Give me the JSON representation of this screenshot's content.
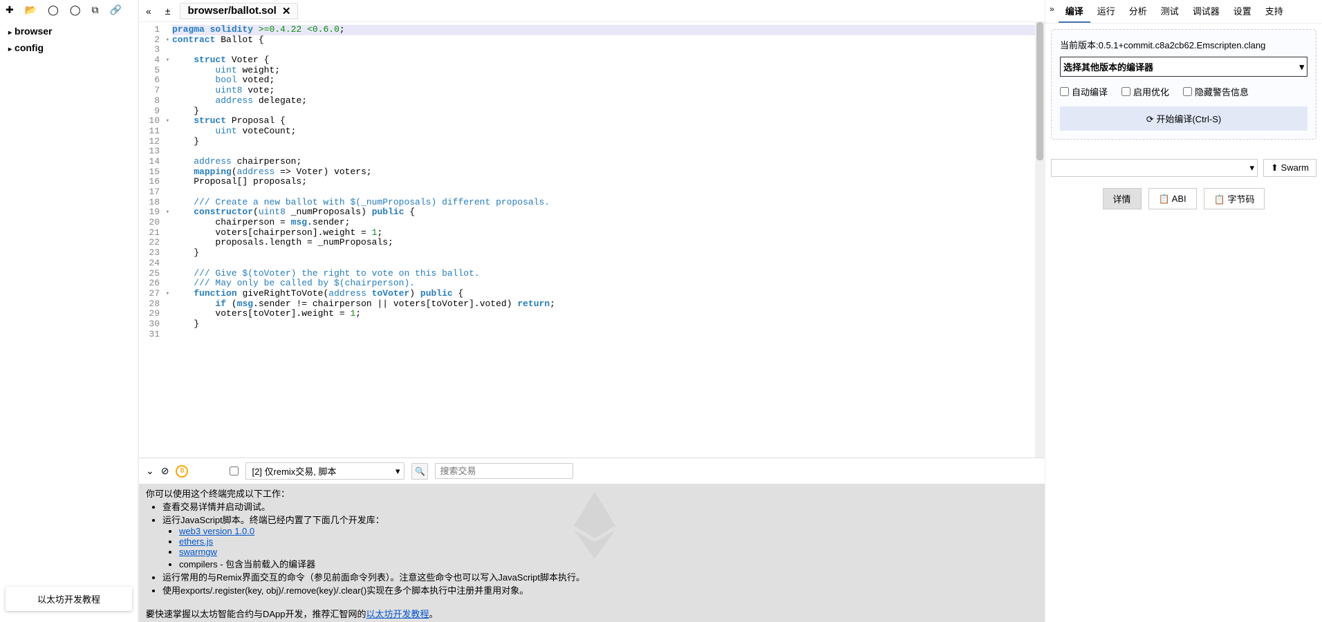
{
  "leftPanel": {
    "treeItems": [
      "browser",
      "config"
    ],
    "tutorialLabel": "以太坊开发教程"
  },
  "tab": {
    "title": "browser/ballot.sol"
  },
  "editor": {
    "lineCount": 31,
    "foldLines": [
      2,
      4,
      10,
      19,
      27
    ]
  },
  "terminalControls": {
    "pendingCount": "0",
    "filterLabel": "[2] 仅remix交易, 脚本",
    "searchPlaceholder": "搜索交易"
  },
  "terminal": {
    "intro": "你可以使用这个终端完成以下工作：",
    "bullets": [
      "查看交易详情并启动调试。",
      "运行JavaScript脚本。终端已经内置了下面几个开发库："
    ],
    "libs": [
      "web3 version 1.0.0",
      "ethers.js",
      "swarmgw"
    ],
    "compilersLine": "compilers - 包含当前载入的编译器",
    "bullets2": [
      "运行常用的与Remix界面交互的命令（参见前面命令列表）。注意这些命令也可以写入JavaScript脚本执行。",
      "使用exports/.register(key, obj)/.remove(key)/.clear()实现在多个脚本执行中注册并重用对象。"
    ],
    "footerText": "要快速掌握以太坊智能合约与DApp开发，推荐汇智网的",
    "footerLink": "以太坊开发教程",
    "prompt": ">"
  },
  "rightPanel": {
    "tabs": [
      "编译",
      "运行",
      "分析",
      "测试",
      "调试器",
      "设置",
      "支持"
    ],
    "activeTab": 0,
    "versionText": "当前版本:0.5.1+commit.c8a2cb62.Emscripten.clang",
    "compilerSelect": "选择其他版本的编译器",
    "opts": {
      "auto": "自动编译",
      "optimize": "启用优化",
      "hideWarn": "隐藏警告信息"
    },
    "compileBtn": "开始编译(Ctrl-S)",
    "swarmBtn": "Swarm",
    "detailBtn": "详情",
    "abiBtn": "ABI",
    "bytecodeBtn": "字节码"
  },
  "code": {
    "l1": {
      "a": "pragma",
      "b": "solidity",
      "c": ">=0.4.22 <0.6.0",
      "d": ";"
    },
    "l2": {
      "a": "contract",
      "b": " Ballot {"
    },
    "l4": {
      "a": "struct",
      "b": " Voter {"
    },
    "l5": {
      "a": "uint",
      "b": " weight;"
    },
    "l6": {
      "a": "bool",
      "b": " voted;"
    },
    "l7": {
      "a": "uint8",
      "b": " vote;"
    },
    "l8": {
      "a": "address",
      "b": " delegate;"
    },
    "l9": "    }",
    "l10": {
      "a": "struct",
      "b": " Proposal {"
    },
    "l11": {
      "a": "uint",
      "b": " voteCount;"
    },
    "l12": "    }",
    "l14": {
      "a": "address",
      "b": " chairperson;"
    },
    "l15": {
      "a": "mapping",
      "b": "(",
      "c": "address",
      "d": " => Voter) voters;"
    },
    "l16": "    Proposal[] proposals;",
    "l18": "    /// Create a new ballot with $(_numProposals) different proposals.",
    "l19": {
      "a": "constructor",
      "b": "(",
      "c": "uint8",
      "d": " _numProposals) ",
      "e": "public",
      "f": " {"
    },
    "l20": {
      "a": "        chairperson = ",
      "b": "msg",
      "c": ".sender;"
    },
    "l21": {
      "a": "        voters[chairperson].weight = ",
      "b": "1",
      "c": ";"
    },
    "l22": "        proposals.length = _numProposals;",
    "l23": "    }",
    "l25": "    /// Give $(toVoter) the right to vote on this ballot.",
    "l26": "    /// May only be called by $(chairperson).",
    "l27": {
      "a": "function",
      "b": " giveRightToVote(",
      "c": "address",
      "d": " toVoter",
      "e": ") ",
      "f": "public",
      "g": " {"
    },
    "l28": {
      "a": "if",
      "b": " (",
      "c": "msg",
      "d": ".sender != chairperson || voters[toVoter].voted) ",
      "e": "return",
      "f": ";"
    },
    "l29": {
      "a": "        voters[toVoter].weight = ",
      "b": "1",
      "c": ";"
    },
    "l30": "    }"
  }
}
